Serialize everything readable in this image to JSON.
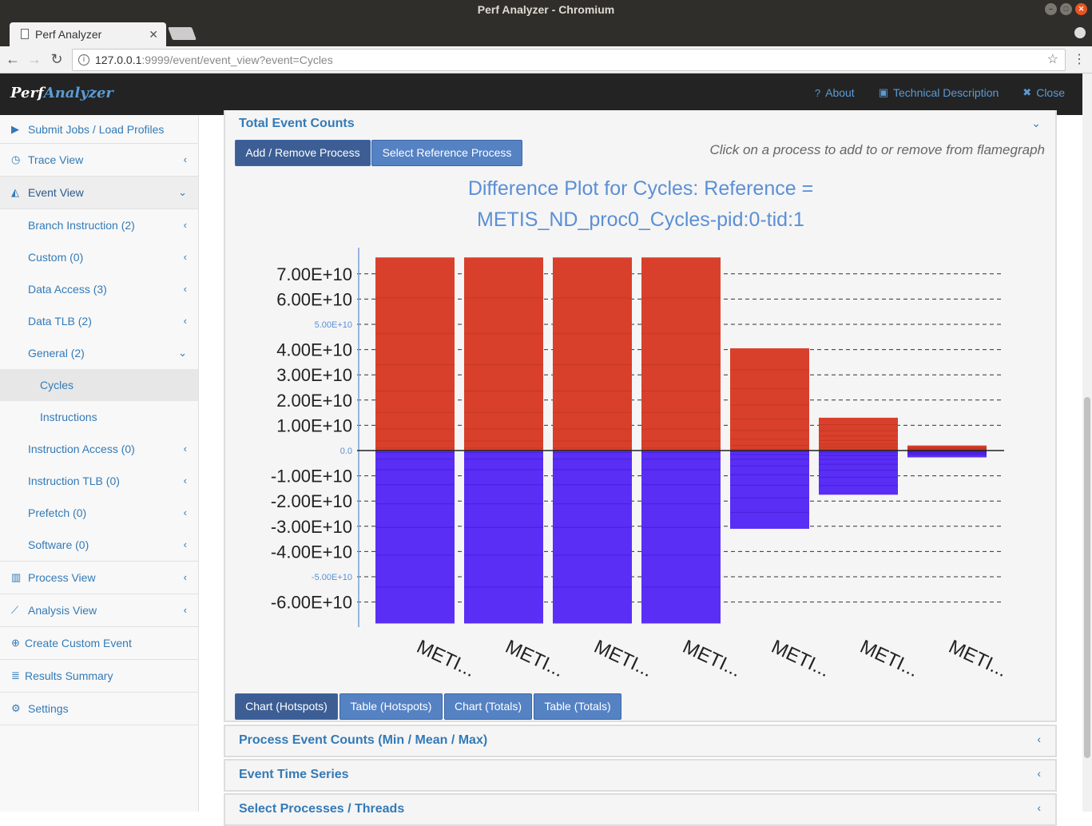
{
  "os": {
    "title": "Perf Analyzer - Chromium"
  },
  "browser": {
    "tab_title": "Perf Analyzer",
    "tab_close": "✕",
    "url_host": "127.0.0.1",
    "url_rest": ":9999/event/event_view?event=Cycles"
  },
  "header": {
    "brand_a": "Perf",
    "brand_b": "Analyzer",
    "links": {
      "about": "About",
      "tech": "Technical Description",
      "close": "Close"
    }
  },
  "sidebar": {
    "submit": "Submit Jobs / Load Profiles",
    "trace": "Trace View",
    "event": "Event View",
    "event_children": [
      "Branch Instruction (2)",
      "Custom (0)",
      "Data Access (3)",
      "Data TLB (2)",
      "General (2)",
      "Cycles",
      "Instructions",
      "Instruction Access (0)",
      "Instruction TLB (0)",
      "Prefetch (0)",
      "Software (0)"
    ],
    "process": "Process View",
    "analysis": "Analysis View",
    "custom_event": "Create Custom Event",
    "results": "Results Summary",
    "settings": "Settings"
  },
  "panel": {
    "title": "Total Event Counts",
    "btn_add": "Add / Remove Process",
    "btn_ref": "Select Reference Process",
    "hint": "Click on a process to add to or remove from flamegraph",
    "tabs": [
      "Chart (Hotspots)",
      "Table (Hotspots)",
      "Chart (Totals)",
      "Table (Totals)"
    ]
  },
  "collapsed_panels": [
    "Process Event Counts (Min / Mean / Max)",
    "Event Time Series",
    "Select Processes / Threads"
  ],
  "colors": {
    "positive": "#d9402b",
    "negative": "#5a2ef5",
    "accent": "#337ab7"
  },
  "chart_data": {
    "type": "bar",
    "title_line1": "Difference Plot for Cycles: Reference =",
    "title_line2": "METIS_ND_proc0_Cycles-pid:0-tid:1",
    "categories": [
      "METI...",
      "METI...",
      "METI...",
      "METI...",
      "METI...",
      "METI...",
      "METI..."
    ],
    "series": [
      {
        "values": [
          76500000000,
          76500000000,
          76500000000,
          76500000000,
          40500000000,
          13000000000,
          2000000000
        ]
      },
      {
        "values": [
          -68500000000,
          -68500000000,
          -68500000000,
          -68500000000,
          -31000000000,
          -17500000000,
          -2700000000
        ]
      }
    ],
    "yticks": [
      {
        "v": 70000000000,
        "label": "7.00E+10",
        "major": true
      },
      {
        "v": 60000000000,
        "label": "6.00E+10",
        "major": true
      },
      {
        "v": 50000000000,
        "label": "5.00E+10",
        "major": false
      },
      {
        "v": 40000000000,
        "label": "4.00E+10",
        "major": true
      },
      {
        "v": 30000000000,
        "label": "3.00E+10",
        "major": true
      },
      {
        "v": 20000000000,
        "label": "2.00E+10",
        "major": true
      },
      {
        "v": 10000000000,
        "label": "1.00E+10",
        "major": true
      },
      {
        "v": 0,
        "label": "0.0",
        "major": false
      },
      {
        "v": -10000000000,
        "label": "-1.00E+10",
        "major": true
      },
      {
        "v": -20000000000,
        "label": "-2.00E+10",
        "major": true
      },
      {
        "v": -30000000000,
        "label": "-3.00E+10",
        "major": true
      },
      {
        "v": -40000000000,
        "label": "-4.00E+10",
        "major": true
      },
      {
        "v": -50000000000,
        "label": "-5.00E+10",
        "major": false
      },
      {
        "v": -60000000000,
        "label": "-6.00E+10",
        "major": true
      }
    ],
    "ylim": [
      -70000000000,
      80000000000
    ]
  }
}
